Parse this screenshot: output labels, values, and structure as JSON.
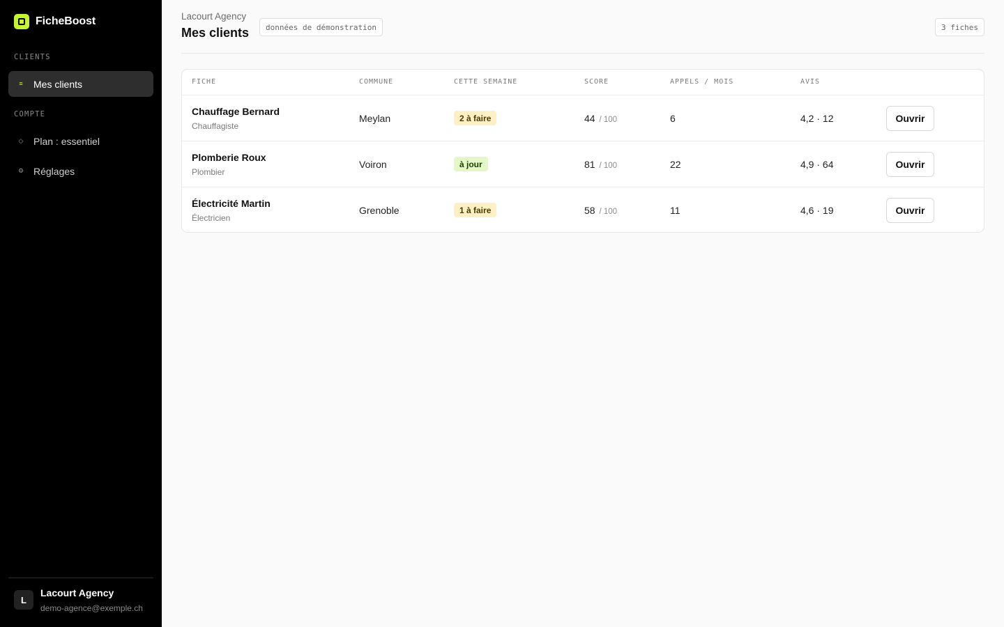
{
  "brand": {
    "name": "FicheBoost",
    "logo_color": "#c6f432"
  },
  "sidebar": {
    "sections": [
      {
        "label": "CLIENTS",
        "items": [
          {
            "label": "Mes clients",
            "icon": "list-icon",
            "active": true
          }
        ]
      },
      {
        "label": "COMPTE",
        "items": [
          {
            "label": "Plan : essentiel",
            "icon": "diamond-icon",
            "active": false
          },
          {
            "label": "Réglages",
            "icon": "gear-icon",
            "active": false
          }
        ]
      }
    ],
    "user": {
      "initial": "L",
      "name": "Lacourt Agency",
      "email": "demo-agence@exemple.ch"
    }
  },
  "header": {
    "agency": "Lacourt Agency",
    "title": "Mes clients",
    "demo_chip": "données de démonstration",
    "count_chip": "3 fiches"
  },
  "table": {
    "columns": [
      "FICHE",
      "COMMUNE",
      "CETTE SEMAINE",
      "SCORE",
      "APPELS / MOIS",
      "AVIS"
    ],
    "rows": [
      {
        "name": "Chauffage Bernard",
        "trade": "Chauffagiste",
        "commune": "Meylan",
        "week": "2 à faire",
        "week_status": "todo",
        "score": "44",
        "score_total": "/ 100",
        "calls": "6",
        "reviews": "4,2 · 12",
        "action": "Ouvrir"
      },
      {
        "name": "Plomberie Roux",
        "trade": "Plombier",
        "commune": "Voiron",
        "week": "à jour",
        "week_status": "ok",
        "score": "81",
        "score_total": "/ 100",
        "calls": "22",
        "reviews": "4,9 · 64",
        "action": "Ouvrir"
      },
      {
        "name": "Électricité Martin",
        "trade": "Électricien",
        "commune": "Grenoble",
        "week": "1 à faire",
        "week_status": "todo",
        "score": "58",
        "score_total": "/ 100",
        "calls": "11",
        "reviews": "4,6 · 19",
        "action": "Ouvrir"
      }
    ]
  },
  "colors": {
    "accent": "#c6f432",
    "badge_todo_bg": "#fdf0c4",
    "badge_ok_bg": "#e3f8c6"
  }
}
